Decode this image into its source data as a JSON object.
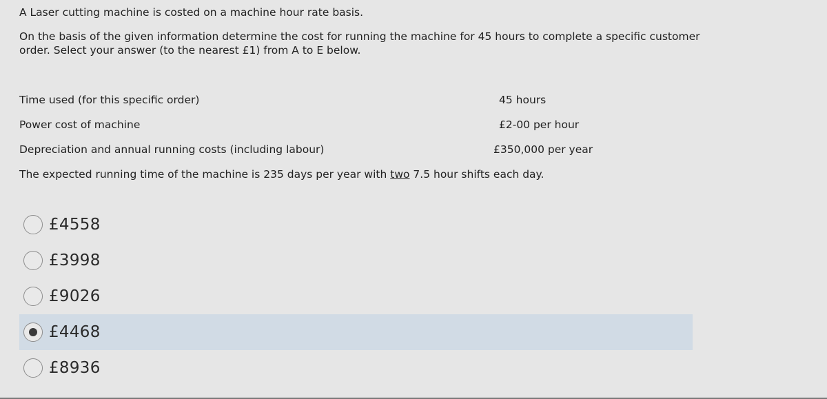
{
  "question": {
    "intro_line1": "A Laser cutting machine is costed on a machine hour rate basis.",
    "intro_line2": "On the basis of the given information determine the cost for running the machine for 45 hours to complete a specific customer order. Select your answer (to the nearest £1) from A to E below.",
    "info": [
      {
        "label": "Time used (for this specific order)",
        "value": "45 hours"
      },
      {
        "label": "Power cost of machine",
        "value": "£2-00 per hour"
      },
      {
        "label": "Depreciation and annual running costs (including labour)",
        "value": "£350,000 per year"
      }
    ],
    "note_before": "The expected running time of the machine is 235 days per year with ",
    "note_underlined": "two",
    "note_after": " 7.5 hour shifts each day."
  },
  "options": [
    {
      "label": "£4558",
      "selected": false
    },
    {
      "label": "£3998",
      "selected": false
    },
    {
      "label": "£9026",
      "selected": false
    },
    {
      "label": "£4468",
      "selected": true
    },
    {
      "label": "£8936",
      "selected": false
    }
  ],
  "colors": {
    "background": "#e6e6e6",
    "selected_highlight": "#d1dbe5",
    "radio_dot": "#3a3a3a"
  }
}
